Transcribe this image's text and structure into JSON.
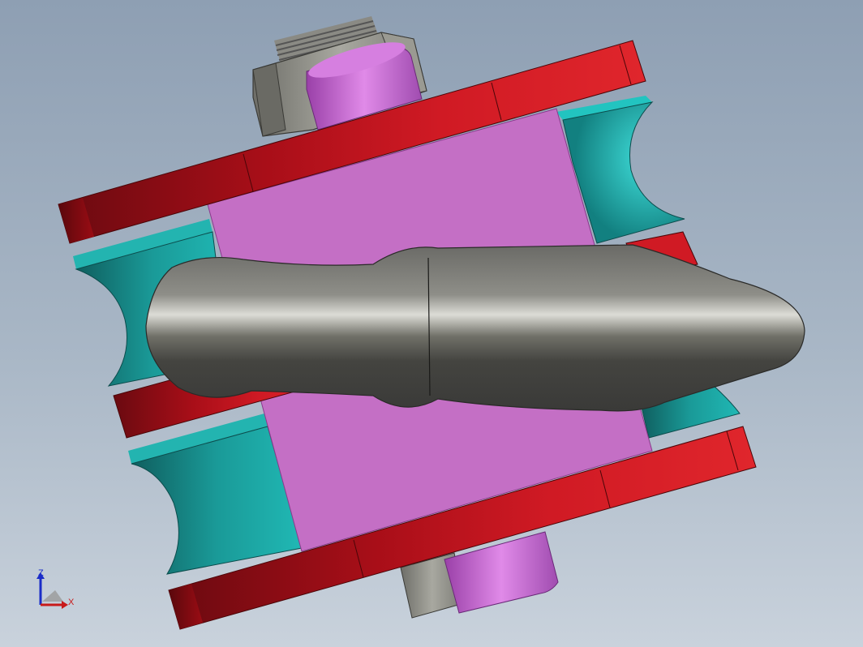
{
  "triad": {
    "z_label": "Z",
    "x_label": "X"
  },
  "colors": {
    "background_top": "#8e9fb3",
    "background_bottom": "#c9d2dc",
    "red_plate": "#c8141c",
    "magenta_block": "#c46fc5",
    "teal_roller": "#1a9c9a",
    "grey_shackle": "#5e5e5e",
    "bolt_grey": "#8a8a82",
    "axis_z": "#1a2cc8",
    "axis_x": "#c81a1a"
  },
  "icons": {
    "triad": "coordinate-triad-icon"
  }
}
